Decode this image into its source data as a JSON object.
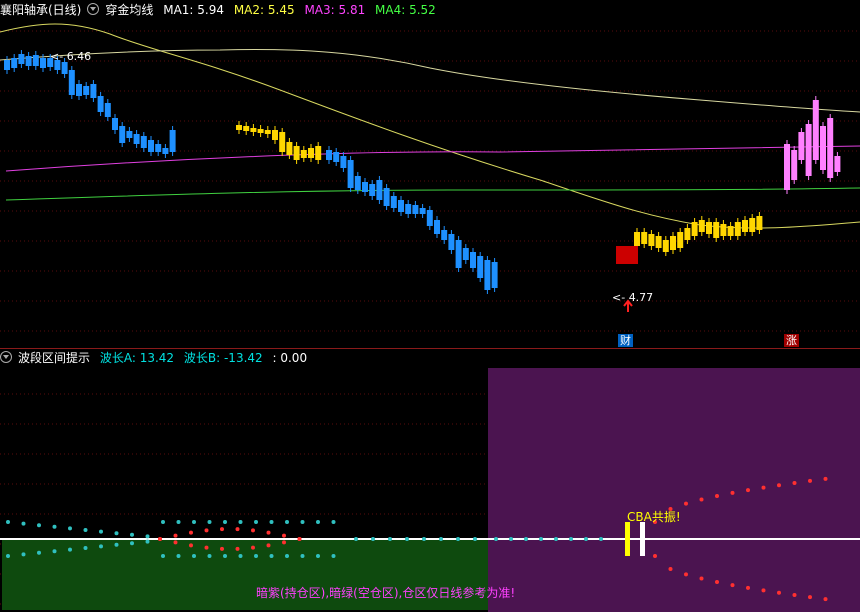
{
  "top_header": {
    "symbol": "襄阳轴承(日线)",
    "indicator": "穿金均线",
    "ma1": "MA1: 5.94",
    "ma2": "MA2: 5.45",
    "ma3": "MA3: 5.81",
    "ma4": "MA4: 5.52"
  },
  "price_labels": {
    "high": "6.46",
    "low": "4.77"
  },
  "markers": {
    "finance": "财",
    "rise": "涨"
  },
  "bottom_header": {
    "indicator": "波段区间提示",
    "wave_a": "波长A: 13.42",
    "wave_b": "波长B: -13.42",
    "value": ": 0.00"
  },
  "cba_label": "CBA共振!",
  "note": "暗紫(持仓区),暗绿(空仓区),仓区仅日线参考为准!",
  "colors": {
    "background": "#000000",
    "down_candle": "#1e90ff",
    "up_candle_yellow": "#ffd700",
    "up_candle_pink": "#ff80ff",
    "ma_yellow": "#d8d860",
    "ma_magenta": "#e040e0",
    "ma_green": "#40d040",
    "hold_zone": "#4b1450",
    "empty_zone": "#0e4a0e"
  }
}
